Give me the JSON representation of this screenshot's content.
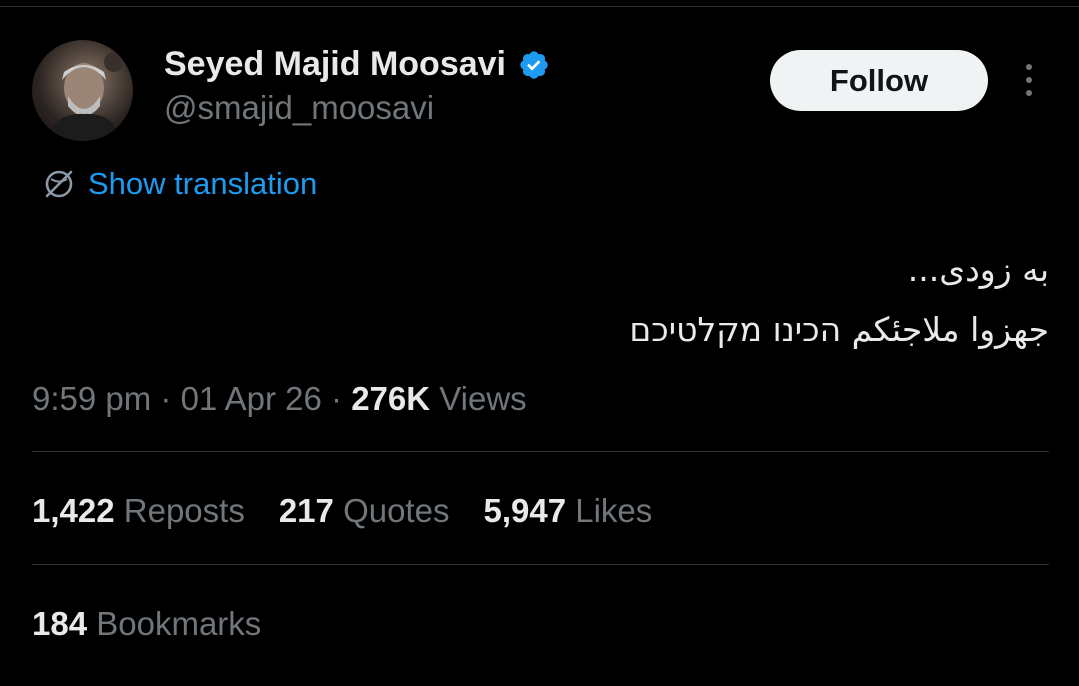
{
  "author": {
    "display_name": "Seyed Majid Moosavi",
    "handle": "@smajid_moosavi",
    "verified_icon": "verified-badge-icon",
    "badge_color": "#1d9bf0"
  },
  "actions": {
    "follow_label": "Follow",
    "more_icon": "more-vertical-icon"
  },
  "translation": {
    "icon": "translate-globe-icon",
    "label": "Show translation"
  },
  "tweet": {
    "lines": [
      "به زودی...",
      "جهزوا ملاجئكم הכינו מקלטיכם"
    ]
  },
  "meta": {
    "time": "9:59 pm",
    "separator": " · ",
    "date": "01 Apr 26",
    "views_count": "276K",
    "views_label": "Views"
  },
  "stats": [
    {
      "count": "1,422",
      "label": "Reposts"
    },
    {
      "count": "217",
      "label": "Quotes"
    },
    {
      "count": "5,947",
      "label": "Likes"
    }
  ],
  "bookmarks": {
    "count": "184",
    "label": "Bookmarks"
  },
  "colors": {
    "background": "#000000",
    "primary_text": "#e7e9ea",
    "secondary_text": "#71767b",
    "link": "#1d9bf0",
    "divider": "#2f3336"
  }
}
